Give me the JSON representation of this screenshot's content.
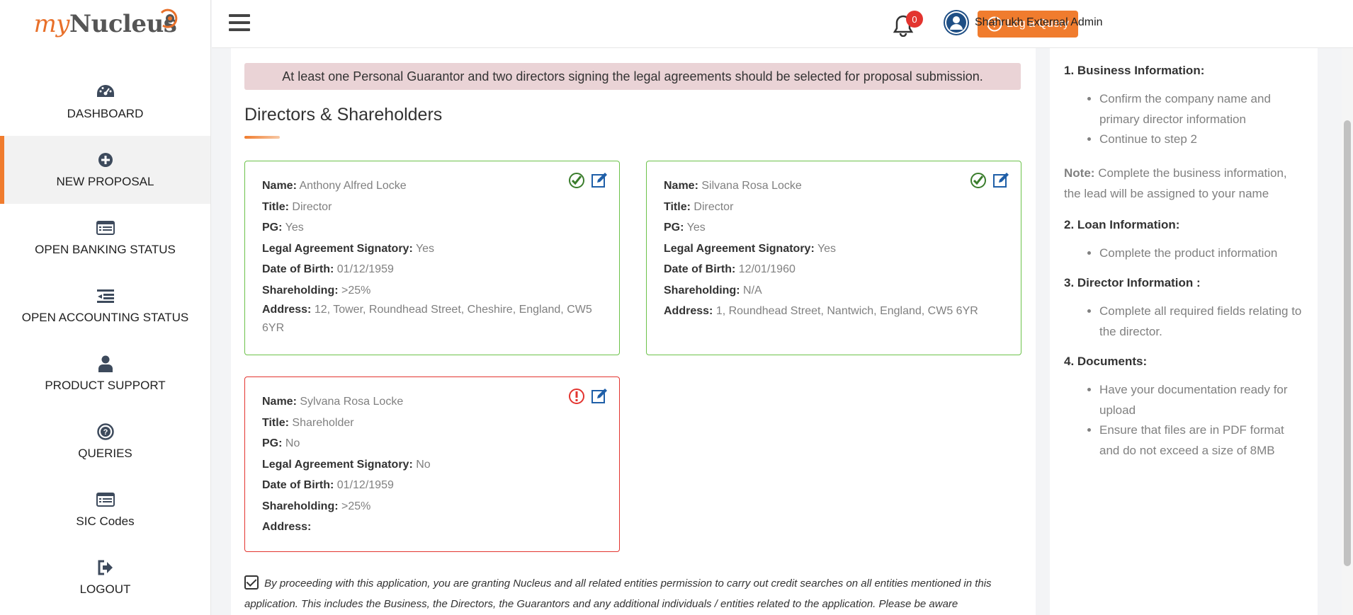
{
  "brand": {
    "part1": "my",
    "part2": "Nucleus"
  },
  "sidebar": {
    "items": [
      {
        "label": "DASHBOARD",
        "icon": "dashboard-icon"
      },
      {
        "label": "NEW PROPOSAL",
        "icon": "plus-circle-icon"
      },
      {
        "label": "OPEN BANKING STATUS",
        "icon": "list-icon"
      },
      {
        "label": "OPEN ACCOUNTING STATUS",
        "icon": "indent-icon"
      },
      {
        "label": "PRODUCT SUPPORT",
        "icon": "user-icon"
      },
      {
        "label": "QUERIES",
        "icon": "question-circle-icon"
      },
      {
        "label": "SIC Codes",
        "icon": "list-icon"
      },
      {
        "label": "LOGOUT",
        "icon": "logout-icon"
      }
    ]
  },
  "header": {
    "query_button": "Log a Query",
    "notification_count": "0",
    "user_name": "Shahrukh External Admin"
  },
  "main": {
    "alert": "At least one Personal Guarantor and two directors signing the legal agreements should be selected for proposal submission.",
    "title": "Directors & Shareholders",
    "labels": {
      "name": "Name:",
      "title": "Title:",
      "pg": "PG:",
      "signatory": "Legal Agreement Signatory:",
      "dob": "Date of Birth:",
      "shareholding": "Shareholding:",
      "address": "Address:"
    },
    "cards": [
      {
        "name": "Anthony Alfred Locke",
        "title": "Director",
        "pg": "Yes",
        "signatory": "Yes",
        "dob": "01/12/1959",
        "shareholding": ">25%",
        "address": "12, Tower, Roundhead Street, Cheshire, England, CW5 6YR",
        "status": "valid"
      },
      {
        "name": "Silvana Rosa Locke",
        "title": "Director",
        "pg": "Yes",
        "signatory": "Yes",
        "dob": "12/01/1960",
        "shareholding": "N/A",
        "address": "1, Roundhead Street, Nantwich, England, CW5 6YR",
        "status": "valid"
      },
      {
        "name": "Sylvana Rosa Locke",
        "title": "Shareholder",
        "pg": "No",
        "signatory": "No",
        "dob": "01/12/1959",
        "shareholding": ">25%",
        "address": "",
        "status": "error"
      }
    ],
    "consent": "By proceeding with this application, you are granting Nucleus and all related entities permission to carry out credit searches on all entities mentioned in this application. This includes the Business, the Directors, the Guarantors and any additional individuals / entities related to the application. Please be aware"
  },
  "help": {
    "s1_title": "1. Business Information:",
    "s1_items": [
      "Confirm the company name and primary director information",
      "Continue to step 2"
    ],
    "note_label": "Note:",
    "note_text": "Complete the business information, the lead will be assigned to your name",
    "s2_title": "2. Loan Information:",
    "s2_items": [
      "Complete the product information"
    ],
    "s3_title": "3. Director Information :",
    "s3_items": [
      "Complete all required fields relating to the director."
    ],
    "s4_title": "4. Documents:",
    "s4_items": [
      "Have your documentation ready for upload",
      "Ensure that files are in PDF format and do not exceed a size of 8MB"
    ]
  },
  "colors": {
    "accent": "#f07c2e",
    "valid": "#6cc24a",
    "error": "#e3342f",
    "edit": "#1f5fa8"
  }
}
